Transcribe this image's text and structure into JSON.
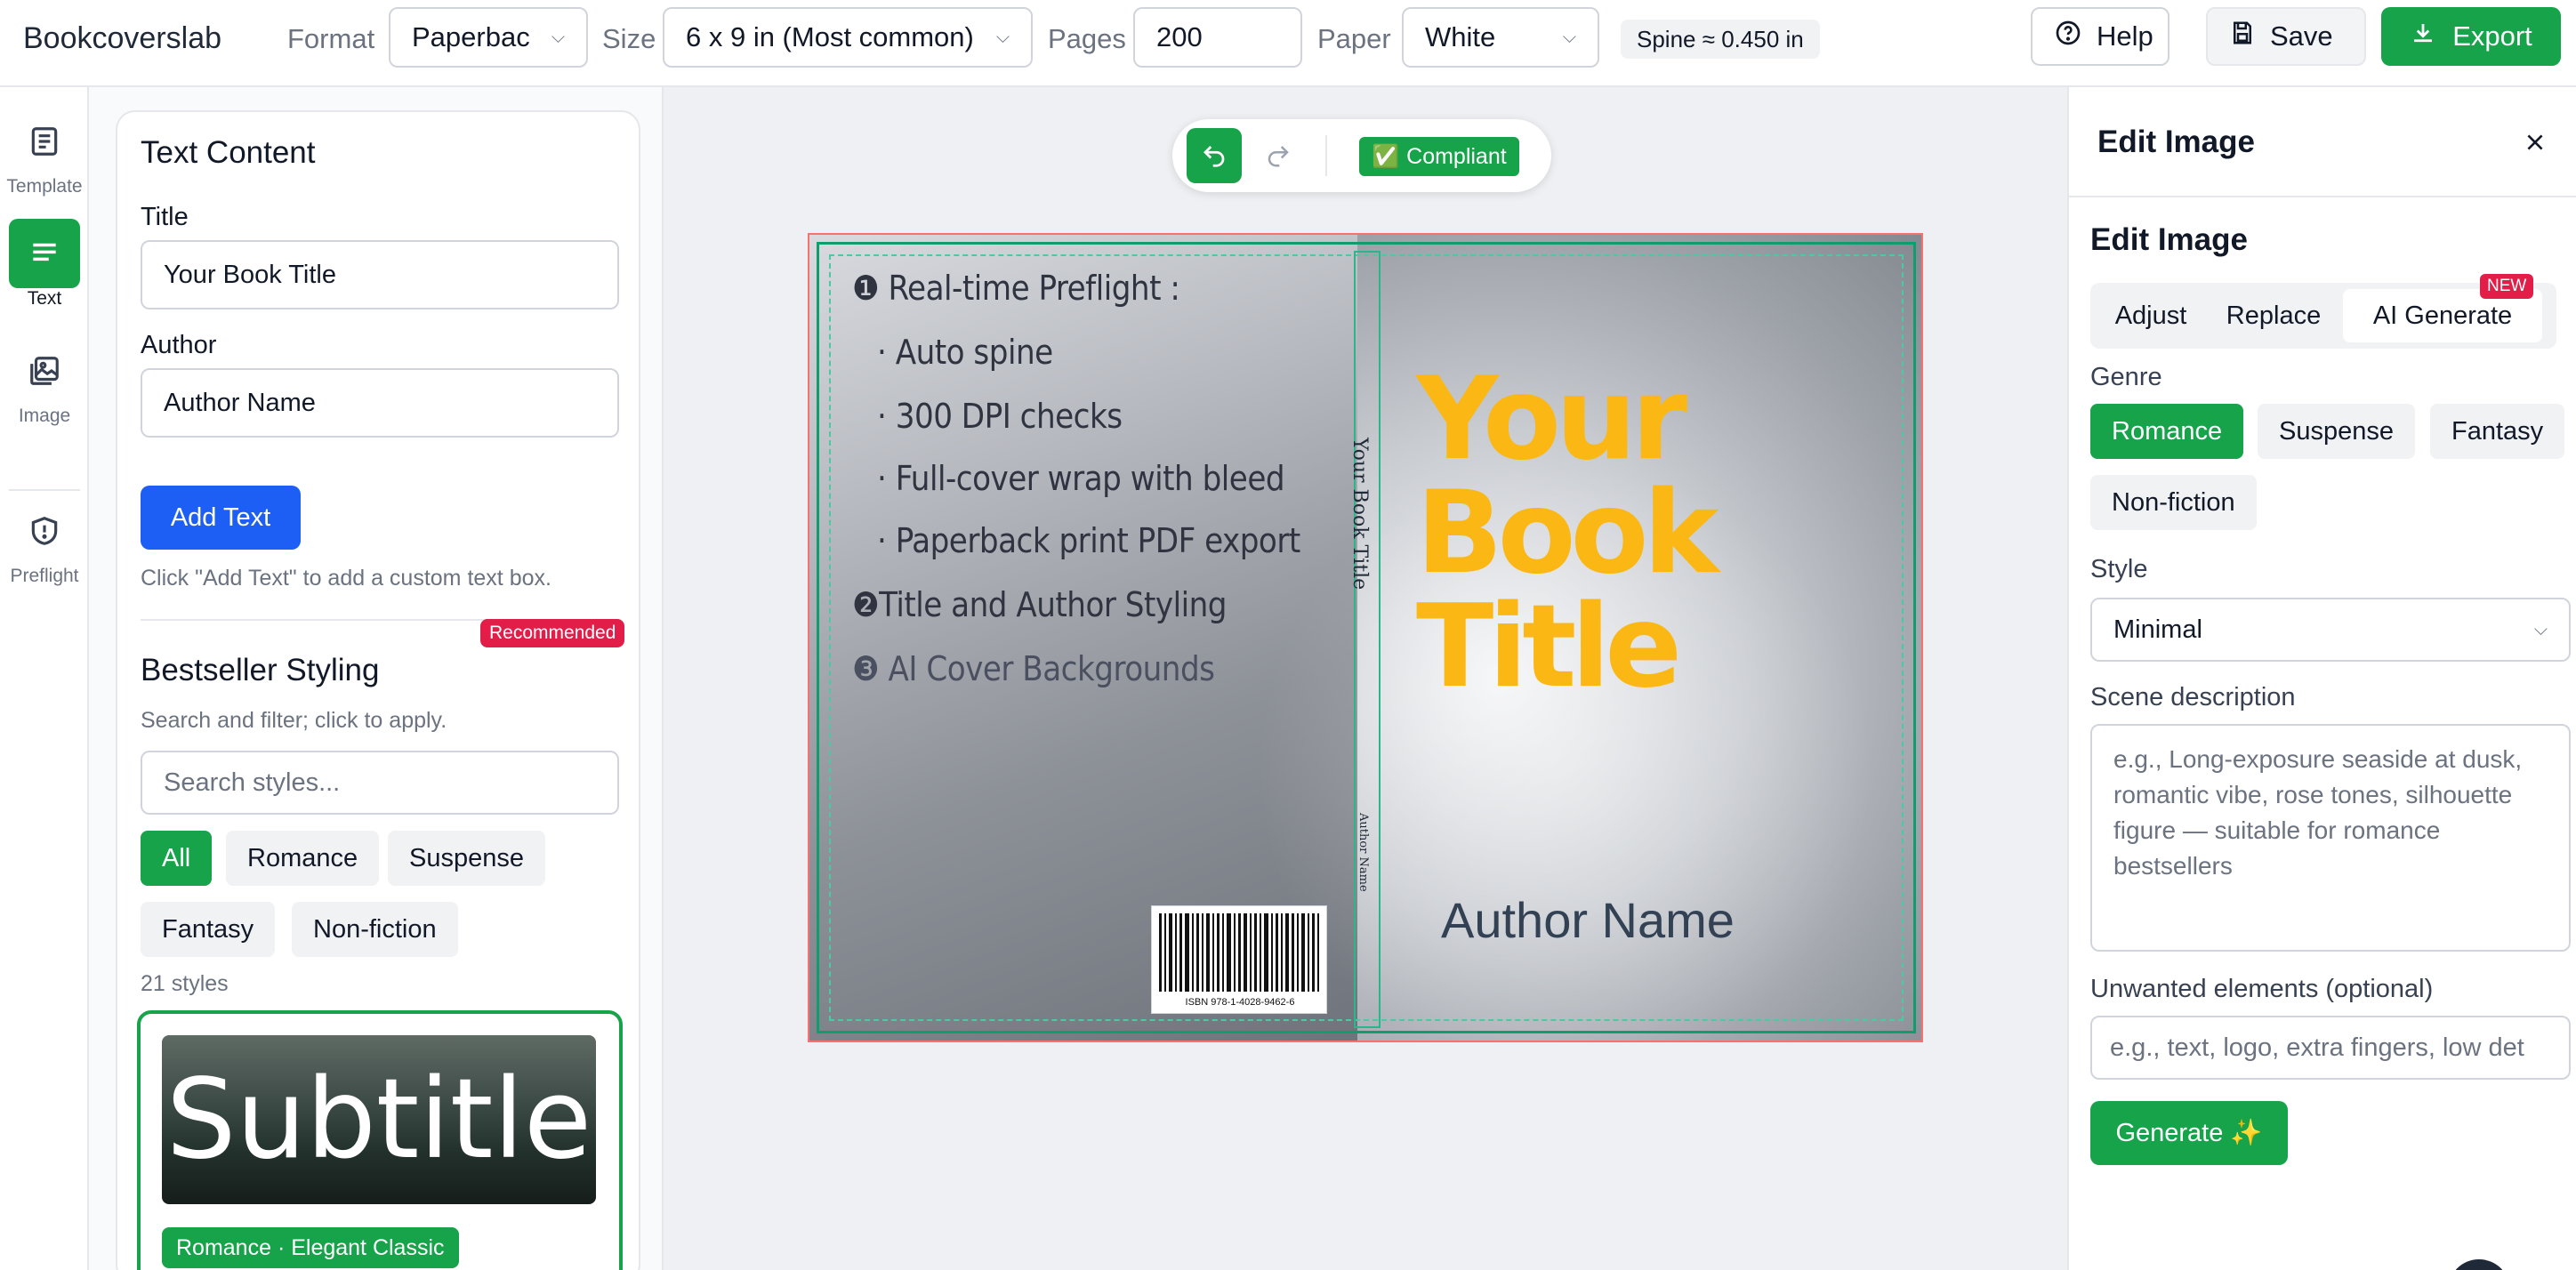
{
  "app": {
    "brand": "Bookcoverslab"
  },
  "toolbar": {
    "format_label": "Format",
    "format_value": "Paperbac",
    "size_label": "Size",
    "size_value": "6 x 9 in (Most common)",
    "pages_label": "Pages",
    "pages_value": "200",
    "paper_label": "Paper",
    "paper_value": "White",
    "spine_text": "Spine ≈ 0.450 in",
    "help_label": "Help",
    "save_label": "Save",
    "export_label": "Export"
  },
  "rail": {
    "items": [
      {
        "label": "Template",
        "icon": "template-icon"
      },
      {
        "label": "Text",
        "icon": "text-icon",
        "active": true
      },
      {
        "label": "Image",
        "icon": "image-icon"
      },
      {
        "label": "Preflight",
        "icon": "shield-icon"
      }
    ]
  },
  "text_panel": {
    "heading": "Text Content",
    "title_label": "Title",
    "title_value": "Your Book Title",
    "author_label": "Author",
    "author_value": "Author Name",
    "add_text_label": "Add Text",
    "add_text_hint": "Click \"Add Text\" to add a custom text box.",
    "styling_heading": "Bestseller Styling",
    "recommended_badge": "Recommended",
    "styling_hint": "Search and filter; click to apply.",
    "search_placeholder": "Search styles...",
    "filters": [
      "All",
      "Romance",
      "Suspense",
      "Fantasy",
      "Non-fiction"
    ],
    "count_text": "21 styles",
    "style_card": {
      "preview_text": "Subtitle",
      "tag": "Romance · Elegant Classic"
    }
  },
  "canvas": {
    "compliant_label": "Compliant",
    "back_lines": [
      "❶ Real-time Preflight :",
      "· Auto spine",
      "· 300 DPI checks",
      "· Full-cover wrap with bleed",
      "· Paperback print PDF export",
      "❷Title and Author Styling",
      "❸ AI Cover Backgrounds"
    ],
    "spine_title": "Your Book Title",
    "spine_author": "Author Name",
    "front_title_lines": [
      "Your",
      "Book",
      "Title"
    ],
    "front_author": "Author Name",
    "isbn": "ISBN 978-1-4028-9462-6",
    "title_color": "#fbb714"
  },
  "edit_panel": {
    "header": "Edit Image",
    "title": "Edit Image",
    "tabs": [
      "Adjust",
      "Replace",
      "AI Generate"
    ],
    "new_badge": "NEW",
    "genre_label": "Genre",
    "genres": [
      "Romance",
      "Suspense",
      "Fantasy",
      "Non-fiction"
    ],
    "style_label": "Style",
    "style_value": "Minimal",
    "scene_label": "Scene description",
    "scene_placeholder": "e.g., Long-exposure seaside at dusk, romantic vibe, rose tones, silhouette figure — suitable for romance bestsellers",
    "unwanted_label": "Unwanted elements (optional)",
    "unwanted_placeholder": "e.g., text, logo, extra fingers, low det",
    "generate_label": "Generate ✨"
  },
  "colors": {
    "accent": "#16a34a",
    "primary_blue": "#1d5ff5",
    "badge_red": "#e11d48"
  }
}
